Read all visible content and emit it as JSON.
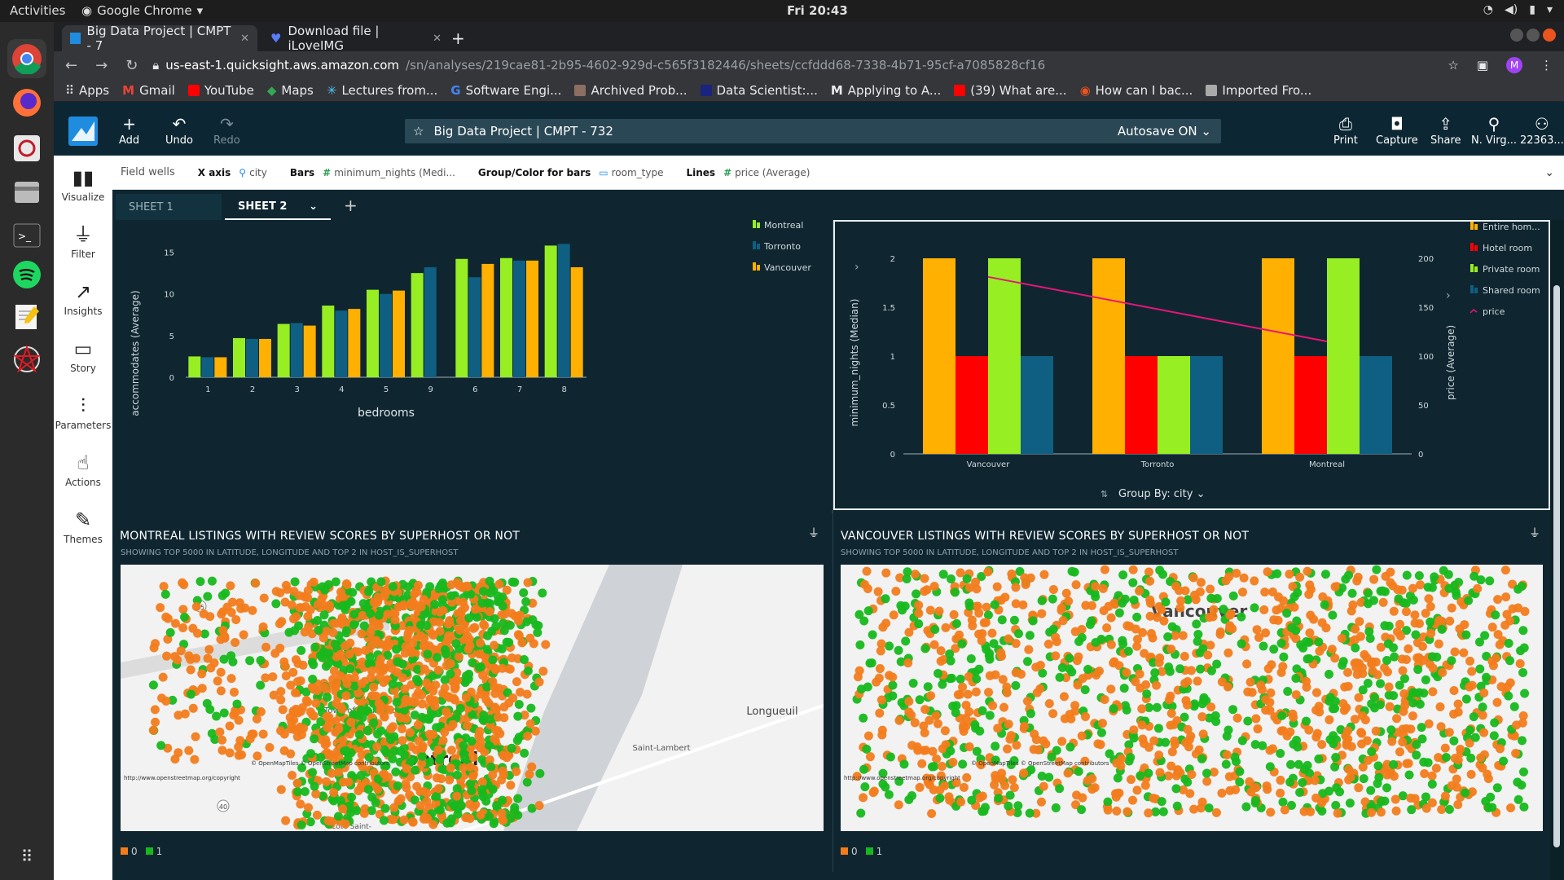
{
  "os": {
    "activities": "Activities",
    "app_name": "Google Chrome",
    "clock": "Fri 20:43"
  },
  "browser": {
    "tabs": [
      {
        "label": "Big Data Project | CMPT - 7",
        "active": true
      },
      {
        "label": "Download file | iLoveIMG",
        "active": false
      }
    ],
    "url_domain": "us-east-1.quicksight.aws.amazon.com",
    "url_path": "/sn/analyses/219cae81-2b95-4602-929d-c565f3182446/sheets/ccfddd68-7338-4b71-95cf-a7085828cf16",
    "profile_initial": "M",
    "bookmarks": [
      "Apps",
      "Gmail",
      "YouTube",
      "Maps",
      "Lectures from...",
      "Software Engi...",
      "Archived Prob...",
      "Data Scientist:...",
      "Applying to A...",
      "(39) What are...",
      "How can I bac...",
      "Imported Fro..."
    ]
  },
  "quicksight": {
    "toolbar": {
      "add": "Add",
      "undo": "Undo",
      "redo": "Redo"
    },
    "analysis_title": "Big Data Project | CMPT - 732",
    "autosave": "Autosave ON",
    "right_actions": [
      "Print",
      "Capture",
      "Share",
      "N. Virg...",
      "22363..."
    ],
    "left_nav": [
      "Visualize",
      "Filter",
      "Insights",
      "Story",
      "Parameters",
      "Actions",
      "Themes"
    ],
    "field_wells": {
      "label": "Field wells",
      "x_axis_label": "X axis",
      "x_axis_value": "city",
      "bars_label": "Bars",
      "bars_value": "minimum_nights (Medi...",
      "group_label": "Group/Color for bars",
      "group_value": "room_type",
      "lines_label": "Lines",
      "lines_value": "price (Average)"
    },
    "sheets": [
      "SHEET 1",
      "SHEET 2"
    ],
    "group_by": "Group By: city"
  },
  "colors": {
    "montreal": "#96ee23",
    "toronto": "#0f5f82",
    "vancouver": "#ffb000",
    "entire_home": "#ffb000",
    "hotel_room": "#ff0000",
    "private_room": "#96ee23",
    "shared_room": "#0f5f82",
    "price_line": "#e8147a",
    "superhost_0": "#f27c1c",
    "superhost_1": "#17b81e"
  },
  "chart_data": [
    {
      "type": "bar",
      "xlabel": "bedrooms",
      "ylabel": "accommodates (Average)",
      "ylim": [
        0,
        17.5
      ],
      "yticks": [
        0,
        5,
        10,
        15
      ],
      "categories": [
        "1",
        "2",
        "3",
        "4",
        "5",
        "9",
        "6",
        "7",
        "8"
      ],
      "series": [
        {
          "name": "Montreal",
          "values": [
            2.5,
            4.7,
            6.4,
            8.6,
            10.5,
            12.5,
            14.2,
            14.3,
            15.8
          ]
        },
        {
          "name": "Torronto",
          "values": [
            2.4,
            4.6,
            6.5,
            8.0,
            10.0,
            13.2,
            12.0,
            14.0,
            16.0
          ]
        },
        {
          "name": "Vancouver",
          "values": [
            2.4,
            4.6,
            6.2,
            8.2,
            10.4,
            null,
            13.6,
            14.0,
            13.2
          ]
        }
      ],
      "legend": "top-right"
    },
    {
      "type": "bar",
      "ylabel": "minimum_nights (Median)",
      "y2label": "price (Average)",
      "ylim": [
        0,
        2
      ],
      "yticks": [
        0,
        0.5,
        1,
        1.5,
        2
      ],
      "y2lim": [
        0,
        200
      ],
      "y2ticks": [
        0,
        50,
        100,
        150,
        200
      ],
      "categories": [
        "Vancouver",
        "Torronto",
        "Montreal"
      ],
      "series": [
        {
          "name": "Entire hom...",
          "values": [
            2,
            2,
            2
          ]
        },
        {
          "name": "Hotel room",
          "values": [
            1,
            1,
            1
          ]
        },
        {
          "name": "Private room",
          "values": [
            2,
            1,
            2
          ]
        },
        {
          "name": "Shared room",
          "values": [
            1,
            1,
            1
          ]
        }
      ],
      "line": {
        "name": "price",
        "values": [
          181,
          148,
          115
        ]
      },
      "legend": "top-right"
    }
  ],
  "maps": [
    {
      "title": "MONTREAL LISTINGS WITH REVIEW SCORES BY SUPERHOST OR NOT",
      "subtitle": "SHOWING TOP 5000 IN LATITUDE, LONGITUDE AND TOP 2 IN HOST_IS_SUPERHOST",
      "place_labels": [
        "Longueuil",
        "Saint-Lambert",
        "Town of Mount-Royal",
        "ontreal",
        "Côte Saint-"
      ],
      "attribution": "© OpenMapTiles © OpenStreetMap contributors",
      "copyright_url": "http://www.openstreetmap.org/copyright",
      "legend": [
        "0",
        "1"
      ],
      "road_marker": "15",
      "road_marker2": "40"
    },
    {
      "title": "VANCOUVER LISTINGS WITH REVIEW SCORES BY SUPERHOST OR NOT",
      "subtitle": "SHOWING TOP 5000 IN LATITUDE, LONGITUDE AND TOP 2 IN HOST_IS_SUPERHOST",
      "place_labels": [
        "Vancouver"
      ],
      "attribution": "© OpenMapTiles © OpenStreetMap contributors",
      "copyright_url": "http://www.openstreetmap.org/copyright",
      "legend": [
        "0",
        "1"
      ]
    }
  ]
}
